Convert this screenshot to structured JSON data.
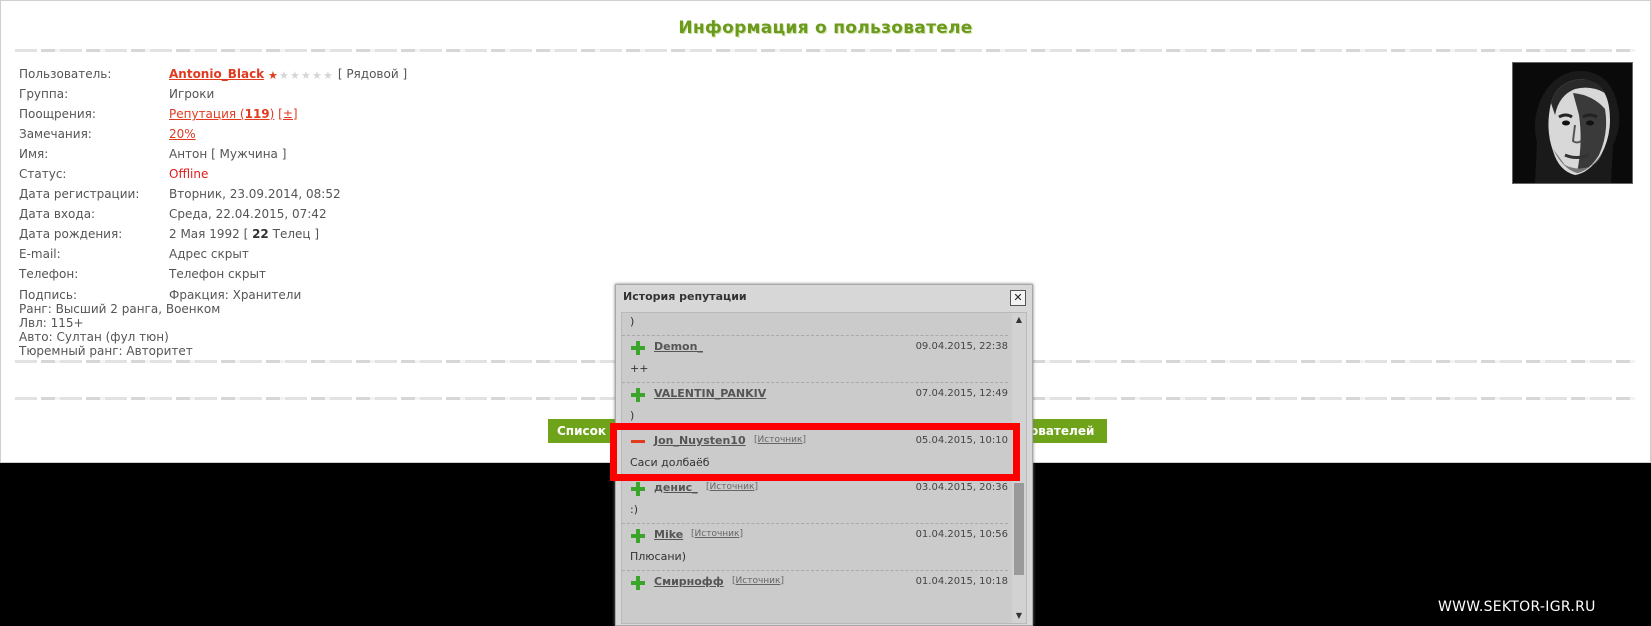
{
  "page": {
    "title": "Информация о пользователе",
    "watermark": "WWW.SEKTOR-IGR.RU"
  },
  "profile": {
    "fields": [
      {
        "label": "Пользователь:",
        "value": "Antonio_Black",
        "rank": "[ Рядовой ]"
      },
      {
        "label": "Группа:",
        "value": "Игроки"
      },
      {
        "label": "Поощрения:",
        "link_prefix": "Репутация (",
        "reputation": "119",
        "link_suffix": ")",
        "plusminus": "[±]"
      },
      {
        "label": "Замечания:",
        "value": "20%"
      },
      {
        "label": "Имя:",
        "value": "Антон",
        "gender": "[ Мужчина ]"
      },
      {
        "label": "Статус:",
        "value": "Offline"
      },
      {
        "label": "Дата регистрации:",
        "value": "Вторник, 23.09.2014, 08:52"
      },
      {
        "label": "Дата входа:",
        "value": "Среда, 22.04.2015, 07:42"
      },
      {
        "label": "Дата рождения:",
        "value": "2 Мая 1992",
        "age_prefix": "[",
        "age": "22",
        "zodiac": "Телец ]"
      },
      {
        "label": "E-mail:",
        "value": "Адрес скрыт"
      },
      {
        "label": "Телефон:",
        "value": "Телефон скрыт"
      },
      {
        "label": "Подпись:",
        "value": "Фракция: Хранители"
      }
    ],
    "rating_stars": 1,
    "rating_total": 6,
    "signature_lines": [
      "Ранг: Высший 2 ранга, Военком",
      "Лвл: 115+",
      "Авто: Султан (фул тюн)",
      "Тюремный ранг: Авторитет"
    ],
    "avatar_icon": "user-avatar-photo"
  },
  "buttons": {
    "left_label": "Список п",
    "right_label": "ователей"
  },
  "popup": {
    "title": "История репутации",
    "close_label": "✕",
    "top_comment": ")",
    "entries": [
      {
        "type": "plus",
        "user": "Demon_",
        "source": "",
        "time": "09.04.2015, 22:38",
        "comment": "++"
      },
      {
        "type": "plus",
        "user": "VALENTIN_PANKIV",
        "source": "",
        "time": "07.04.2015, 12:49",
        "comment": ")"
      },
      {
        "type": "minus",
        "user": "Jon_Nuysten10",
        "source": "Источник",
        "time": "05.04.2015, 10:10",
        "comment": "Саси долбаёб"
      },
      {
        "type": "plus",
        "user": "денис_",
        "source": "Источник",
        "time": "03.04.2015, 20:36",
        "comment": ":)"
      },
      {
        "type": "plus",
        "user": "Mike",
        "source": "Источник",
        "time": "01.04.2015, 10:56",
        "comment": "Плюсани)"
      },
      {
        "type": "plus",
        "user": "Смирнофф",
        "source": "Источник",
        "time": "01.04.2015, 10:18",
        "comment": ""
      }
    ]
  },
  "colors": {
    "accent_green": "#6fa31a",
    "link_red": "#e03b1f",
    "highlight_red": "#ff0000"
  }
}
